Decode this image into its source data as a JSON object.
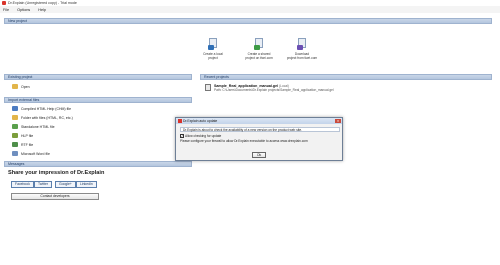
{
  "window": {
    "title": "Dr.Explain (Unregistered copy) - Trial mode"
  },
  "menu": {
    "items": [
      "File",
      "Options",
      "Help"
    ]
  },
  "new_project": {
    "header": "New project",
    "actions": [
      {
        "label_line1": "Create a local",
        "label_line2": "project"
      },
      {
        "label_line1": "Create a shared",
        "label_line2": "project on tiwri.com"
      },
      {
        "label_line1": "Download",
        "label_line2": "project from tiwri.com"
      }
    ]
  },
  "existing_project": {
    "header": "Existing project",
    "open_label": "Open"
  },
  "recent_projects": {
    "header": "Recent projects",
    "items": [
      {
        "name": "Sample_Real_application_manual.gel",
        "meta": "(Local)",
        "path": "Path: C:\\Users\\Documents\\Dr.Explain projects\\Sample_Real_application_manual.gel"
      }
    ]
  },
  "import_external": {
    "header": "Import external files",
    "items": [
      "Compiled HTML Help (CHM) file",
      "Folder with files (HTML, RC, etc.)",
      "Standalone HTML file",
      "HLP file",
      "RTF file",
      "Microsoft Word file"
    ]
  },
  "messages": {
    "header": "Messages",
    "title": "Share your impression of Dr.Explain",
    "social": [
      "Facebook",
      "Twitter",
      "Google+",
      "LinkedIn"
    ],
    "contact_label": "Contact developers"
  },
  "dialog": {
    "title": "Dr.Explain auto update",
    "message1": "Dr.Explain is about to check the availability of a new version on the product web site.",
    "checkbox_label": "Allow checking for update",
    "message2": "Please configure your firewall to allow Dr.Explain executable to access www.drexplain.com",
    "ok_label": "Ok"
  },
  "colors": {
    "header_bg": "#b4c6de",
    "accent": "#1f3b63",
    "logo": "#d9342b"
  }
}
